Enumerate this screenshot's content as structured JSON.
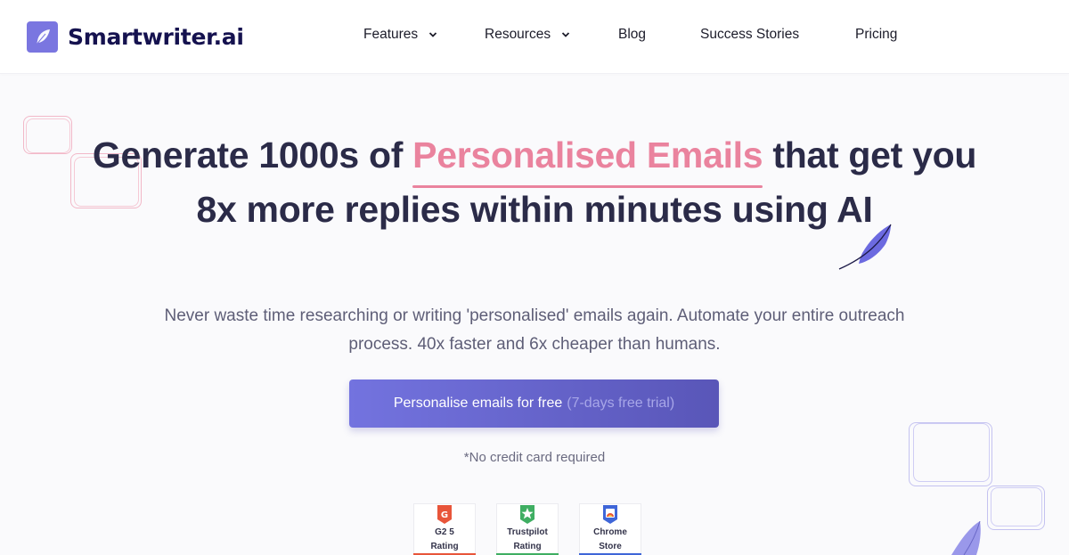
{
  "header": {
    "brand": "Smartwriter.ai",
    "logo_icon": "feather-icon",
    "nav": [
      {
        "label": "Features",
        "has_dropdown": true
      },
      {
        "label": "Resources",
        "has_dropdown": true
      },
      {
        "label": "Blog",
        "has_dropdown": false
      },
      {
        "label": "Success Stories",
        "has_dropdown": false
      },
      {
        "label": "Pricing",
        "has_dropdown": false
      }
    ]
  },
  "hero": {
    "headline_pre": "Generate 1000s of ",
    "headline_highlight": "Personalised Emails",
    "headline_post": " that get you 8x more replies within minutes using AI",
    "subheadline": "Never waste time researching or writing 'personalised' emails again. Automate your entire outreach process. 40x faster and 6x cheaper than humans.",
    "cta_label": "Personalise emails for free",
    "cta_muted": "(7-days free trial)",
    "note": "*No credit card required"
  },
  "badges": [
    {
      "line1": "G2 5",
      "line2": "Rating",
      "icon": "g2-icon",
      "color": "#e8553a"
    },
    {
      "line1": "Trustpilot",
      "line2": "Rating",
      "icon": "trustpilot-star-icon",
      "color": "#3fae62"
    },
    {
      "line1": "Chrome",
      "line2": "Store",
      "icon": "chrome-store-icon",
      "color": "#3f66d8"
    }
  ],
  "colors": {
    "brand": "#7a76e0",
    "brand_dark": "#15124f",
    "highlight": "#ea839e",
    "heading": "#2b2b48",
    "cta_start": "#7373df",
    "cta_end": "#5956b8"
  }
}
